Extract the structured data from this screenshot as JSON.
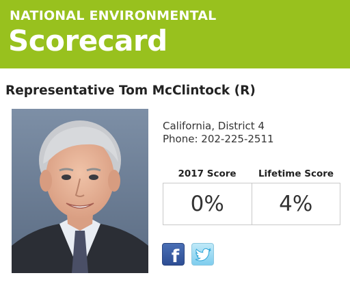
{
  "banner": {
    "kicker": "NATIONAL ENVIRONMENTAL",
    "title": "Scorecard",
    "color": "#98c11e"
  },
  "representative": {
    "name": "Representative Tom McClintock (R)",
    "location": "California, District 4",
    "phone": "Phone: 202-225-2511"
  },
  "scores": {
    "year_label": "2017 Score",
    "year_value": "0%",
    "lifetime_label": "Lifetime Score",
    "lifetime_value": "4%"
  },
  "social": {
    "facebook_icon": "facebook-icon",
    "twitter_icon": "twitter-icon"
  }
}
